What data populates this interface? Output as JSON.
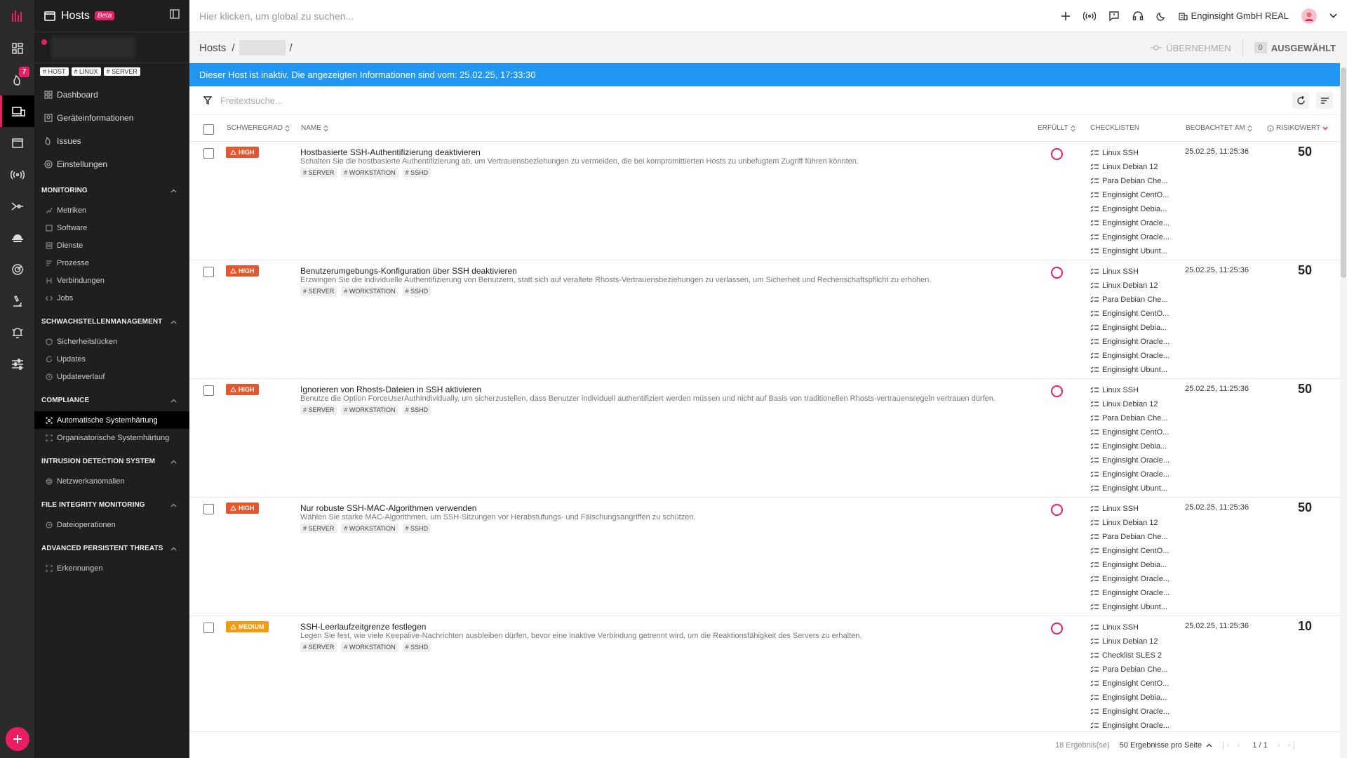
{
  "app": {
    "title": "Hosts",
    "beta_label": "Beta"
  },
  "rail": {
    "issues_badge": "7"
  },
  "host_tags": [
    "HOST",
    "LINUX",
    "SERVER"
  ],
  "nav": {
    "top": [
      "Dashboard",
      "Geräteinformationen",
      "Issues",
      "Einstellungen"
    ],
    "sections": [
      {
        "title": "MONITORING",
        "items": [
          "Metriken",
          "Software",
          "Dienste",
          "Prozesse",
          "Verbindungen",
          "Jobs"
        ]
      },
      {
        "title": "SCHWACHSTELLENMANAGEMENT",
        "items": [
          "Sicherheitslücken",
          "Updates",
          "Updateverlauf"
        ]
      },
      {
        "title": "COMPLIANCE",
        "items": [
          "Automatische Systemhärtung",
          "Organisatorische Systemhärtung"
        ]
      },
      {
        "title": "INTRUSION DETECTION SYSTEM",
        "items": [
          "Netzwerkanomalien"
        ]
      },
      {
        "title": "FILE INTEGRITY MONITORING",
        "items": [
          "Dateioperationen"
        ]
      },
      {
        "title": "ADVANCED PERSISTENT THREATS",
        "items": [
          "Erkennungen"
        ]
      }
    ]
  },
  "topbar": {
    "search_placeholder": "Hier klicken, um global zu suchen...",
    "company": "Enginsight GmbH REAL"
  },
  "breadcrumb": {
    "root": "Hosts",
    "sep": "/",
    "apply_label": "ÜBERNEHMEN",
    "selected_count": "0",
    "selected_label": "AUSGEWÄHLT"
  },
  "banner": "Dieser Host ist inaktiv. Die angezeigten Informationen sind vom: 25.02.25, 17:33:30",
  "filter": {
    "placeholder": "Freitextsuche..."
  },
  "columns": {
    "severity": "SCHWEREGRAD",
    "name": "NAME",
    "fulfilled": "ERFÜLLT",
    "checklists": "CHECKLISTEN",
    "observed": "BEOBACHTET AM",
    "risk": "RISIKOWERT"
  },
  "rows": [
    {
      "severity": "HIGH",
      "name": "Hostbasierte SSH-Authentifizierung deaktivieren",
      "desc": "Schalten Sie die hostbasierte Authentifizierung ab, um Vertrauensbeziehungen zu vermeiden, die bei kompromittierten Hosts zu unbefugtem Zugriff führen könnten.",
      "tags": [
        "SERVER",
        "WORKSTATION",
        "SSHD"
      ],
      "checklists": [
        "Linux SSH",
        "Linux Debian 12",
        "Para Debian Che...",
        "Enginsight CentO...",
        "Enginsight Debia...",
        "Enginsight Oracle...",
        "Enginsight Oracle...",
        "Enginsight Ubunt..."
      ],
      "date": "25.02.25, 11:25:36",
      "risk": "50"
    },
    {
      "severity": "HIGH",
      "name": "Benutzerumgebungs-Konfiguration über SSH deaktivieren",
      "desc": "Erzwingen Sie die individuelle Authentifizierung von Benutzern, statt sich auf veraltete Rhosts-Vertrauensbeziehungen zu verlassen, um Sicherheit und Rechenschaftspflicht zu erhöhen.",
      "tags": [
        "SERVER",
        "WORKSTATION",
        "SSHD"
      ],
      "checklists": [
        "Linux SSH",
        "Linux Debian 12",
        "Para Debian Che...",
        "Enginsight CentO...",
        "Enginsight Debia...",
        "Enginsight Oracle...",
        "Enginsight Oracle...",
        "Enginsight Ubunt..."
      ],
      "date": "25.02.25, 11:25:36",
      "risk": "50"
    },
    {
      "severity": "HIGH",
      "name": "Ignorieren von Rhosts-Dateien in SSH aktivieren",
      "desc": "Benutze die Option ForceUserAuthIndividually, um sicherzustellen, dass Benutzer individuell authentifiziert werden müssen und nicht auf Basis von traditionellen Rhosts-vertrauensregeln vertrauen dürfen.",
      "tags": [
        "SERVER",
        "WORKSTATION",
        "SSHD"
      ],
      "checklists": [
        "Linux SSH",
        "Linux Debian 12",
        "Para Debian Che...",
        "Enginsight CentO...",
        "Enginsight Debia...",
        "Enginsight Oracle...",
        "Enginsight Oracle...",
        "Enginsight Ubunt..."
      ],
      "date": "25.02.25, 11:25:36",
      "risk": "50"
    },
    {
      "severity": "HIGH",
      "name": "Nur robuste SSH-MAC-Algorithmen verwenden",
      "desc": "Wählen Sie starke MAC-Algorithmen, um SSH-Sitzungen vor Herabstufungs- und Fälschungsangriffen zu schützen.",
      "tags": [
        "SERVER",
        "WORKSTATION",
        "SSHD"
      ],
      "checklists": [
        "Linux SSH",
        "Linux Debian 12",
        "Para Debian Che...",
        "Enginsight CentO...",
        "Enginsight Debia...",
        "Enginsight Oracle...",
        "Enginsight Oracle...",
        "Enginsight Ubunt..."
      ],
      "date": "25.02.25, 11:25:36",
      "risk": "50"
    },
    {
      "severity": "MEDIUM",
      "name": "SSH-Leerlaufzeitgrenze festlegen",
      "desc": "Legen Sie fest, wie viele Keepalive-Nachrichten ausbleiben dürfen, bevor eine inaktive Verbindung getrennt wird, um die Reaktionsfähigkeit des Servers zu erhalten.",
      "tags": [
        "SERVER",
        "WORKSTATION",
        "SSHD"
      ],
      "checklists": [
        "Linux SSH",
        "Linux Debian 12",
        "Checklist SLES 2",
        "Para Debian Che...",
        "Enginsight CentO...",
        "Enginsight Debia...",
        "Enginsight Oracle...",
        "Enginsight Oracle..."
      ],
      "date": "25.02.25, 11:25:36",
      "risk": "10"
    }
  ],
  "pager": {
    "results": "18 Ergebnis(se)",
    "per_page": "50 Ergebnisse pro Seite",
    "pages": "1 / 1"
  }
}
